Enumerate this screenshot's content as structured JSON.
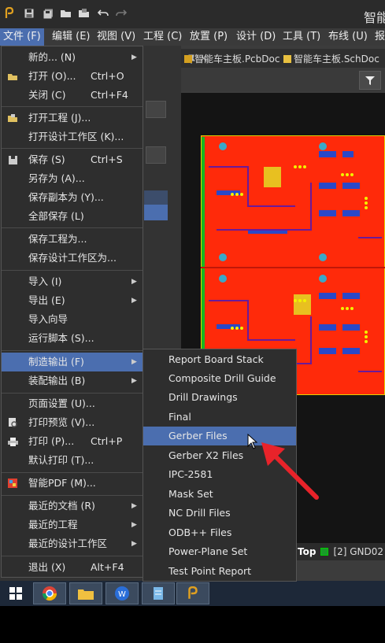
{
  "window": {
    "title": "智能"
  },
  "menubar": [
    {
      "label": "文件 (F)",
      "active": true
    },
    {
      "label": "编辑 (E)"
    },
    {
      "label": "视图 (V)"
    },
    {
      "label": "工程 (C)"
    },
    {
      "label": "放置 (P)"
    },
    {
      "label": "设计 (D)"
    },
    {
      "label": "工具 (T)"
    },
    {
      "label": "布线 (U)"
    },
    {
      "label": "报"
    }
  ],
  "doc_tabs": [
    {
      "label": "智能车主板.PcbDoc",
      "icon": "pcb-doc-icon"
    },
    {
      "label": "智能车主板.SchDoc",
      "icon": "sch-doc-icon"
    }
  ],
  "file_menu": [
    {
      "label": "新的... (N)",
      "arrow": true
    },
    {
      "label": "打开 (O)...",
      "shortcut": "Ctrl+O",
      "icon": "folder-open-icon"
    },
    {
      "label": "关闭 (C)",
      "shortcut": "Ctrl+F4"
    },
    {
      "label": "打开工程 (J)...",
      "icon": "open-project-icon"
    },
    {
      "label": "打开设计工作区 (K)..."
    },
    {
      "label": "保存 (S)",
      "shortcut": "Ctrl+S",
      "icon": "save-icon"
    },
    {
      "label": "另存为 (A)..."
    },
    {
      "label": "保存副本为 (Y)..."
    },
    {
      "label": "全部保存 (L)"
    },
    {
      "label": "保存工程为..."
    },
    {
      "label": "保存设计工作区为..."
    },
    {
      "label": "导入 (I)",
      "arrow": true
    },
    {
      "label": "导出 (E)",
      "arrow": true
    },
    {
      "label": "导入向导"
    },
    {
      "label": "运行脚本 (S)..."
    },
    {
      "label": "制造输出 (F)",
      "arrow": true,
      "highlighted": true
    },
    {
      "label": "装配输出 (B)",
      "arrow": true
    },
    {
      "label": "页面设置 (U)..."
    },
    {
      "label": "打印预览 (V)...",
      "icon": "print-preview-icon"
    },
    {
      "label": "打印 (P)...",
      "shortcut": "Ctrl+P",
      "icon": "printer-icon"
    },
    {
      "label": "默认打印 (T)..."
    },
    {
      "label": "智能PDF (M)...",
      "icon": "pdf-icon"
    },
    {
      "label": "最近的文档 (R)",
      "arrow": true
    },
    {
      "label": "最近的工程",
      "arrow": true
    },
    {
      "label": "最近的设计工作区",
      "arrow": true
    },
    {
      "label": "退出 (X)",
      "shortcut": "Alt+F4"
    }
  ],
  "fab_submenu": [
    {
      "label": "Report Board Stack"
    },
    {
      "label": "Composite Drill Guide"
    },
    {
      "label": "Drill Drawings"
    },
    {
      "label": "Final"
    },
    {
      "label": "Gerber Files",
      "highlighted": true
    },
    {
      "label": "Gerber X2 Files"
    },
    {
      "label": "IPC-2581"
    },
    {
      "label": "Mask Set"
    },
    {
      "label": "NC Drill Files"
    },
    {
      "label": "ODB++ Files"
    },
    {
      "label": "Power-Plane Set"
    },
    {
      "label": "Test Point Report"
    }
  ],
  "layer_bar": {
    "active_layer": "Top",
    "next_layer": "[2] GND02"
  },
  "colors": {
    "highlight": "#4b6eaf",
    "board": "#ff2a0a",
    "annotation_arrow": "#e8232a"
  }
}
